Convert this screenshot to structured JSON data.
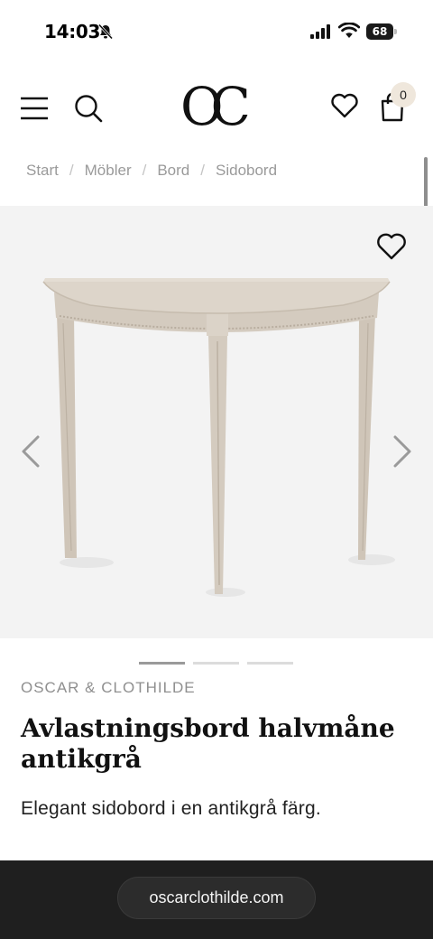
{
  "status_bar": {
    "time": "14:03",
    "battery": "68",
    "icons": [
      "bell-slash-icon",
      "signal-icon",
      "wifi-icon",
      "battery-icon"
    ]
  },
  "header": {
    "logo_text": "OC",
    "menu_icon": "hamburger-menu-icon",
    "search_icon": "search-icon",
    "wishlist_icon": "heart-icon",
    "cart_icon": "shopping-bag-icon",
    "cart_count": "0"
  },
  "breadcrumb": {
    "items": [
      "Start",
      "Möbler",
      "Bord",
      "Sidobord"
    ],
    "separator": "/"
  },
  "gallery": {
    "image_count": 3,
    "active_index": 0,
    "favorite_icon": "heart-outline-icon",
    "prev_icon": "chevron-left-icon",
    "next_icon": "chevron-right-icon"
  },
  "product": {
    "brand": "OSCAR & CLOTHILDE",
    "title": "Avlastningsbord halvmåne antikgrå",
    "description": "Elegant sidobord i en antikgrå färg."
  },
  "browser": {
    "url": "oscarclothilde.com"
  },
  "colors": {
    "gallery_bg": "#f3f3f3",
    "table_color": "#d6cdc1",
    "badge_bg": "#efe7dc",
    "browser_bar": "#1f1f1f"
  }
}
